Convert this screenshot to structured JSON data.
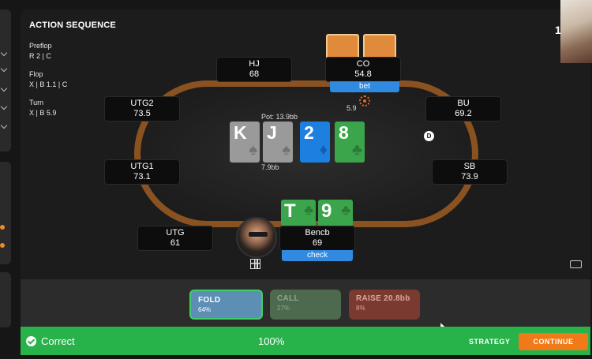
{
  "action_sequence": {
    "title": "ACTION SEQUENCE",
    "streets": [
      {
        "name": "Preflop",
        "actions": "R 2 | C"
      },
      {
        "name": "Flop",
        "actions": "X | B 1.1 | C"
      },
      {
        "name": "Turn",
        "actions": "X | B 5.9"
      }
    ]
  },
  "seats": {
    "hj": {
      "position": "HJ",
      "stack": "68"
    },
    "co": {
      "position": "CO",
      "stack": "54.8",
      "action": "bet",
      "bet": "5.9"
    },
    "utg2": {
      "position": "UTG2",
      "stack": "73.5"
    },
    "bu": {
      "position": "BU",
      "stack": "69.2"
    },
    "utg1": {
      "position": "UTG1",
      "stack": "73.1"
    },
    "sb": {
      "position": "SB",
      "stack": "73.9"
    },
    "utg": {
      "position": "UTG",
      "stack": "61"
    },
    "hero": {
      "name": "Bencb",
      "stack": "69",
      "action": "check"
    }
  },
  "pot": {
    "label": "Pot: 13.9bb",
    "in_pot": "7.9bb"
  },
  "board": [
    {
      "rank": "K",
      "suit": "♠",
      "color": "#9a9a9a"
    },
    {
      "rank": "J",
      "suit": "♠",
      "color": "#9a9a9a"
    },
    {
      "rank": "2",
      "suit": "♦",
      "color": "#1d7fe0"
    },
    {
      "rank": "8",
      "suit": "♣",
      "color": "#3aa54a"
    }
  ],
  "hero_cards": [
    {
      "rank": "T",
      "suit": "♣"
    },
    {
      "rank": "9",
      "suit": "♣"
    }
  ],
  "dealer_button": "D",
  "actions": {
    "fold": {
      "label": "FOLD",
      "freq": "64%"
    },
    "call": {
      "label": "CALL",
      "freq": "27%"
    },
    "raise": {
      "label": "RAISE 20.8bb",
      "freq": "8%"
    }
  },
  "result": {
    "status": "Correct",
    "score": "100%",
    "strategy_label": "STRATEGY",
    "continue_label": "CONTINUE"
  },
  "webcam_overlay_text": "1",
  "colors": {
    "accent_orange": "#f07a18",
    "success_green": "#27b24a",
    "bet_blue": "#2f8ae0"
  }
}
